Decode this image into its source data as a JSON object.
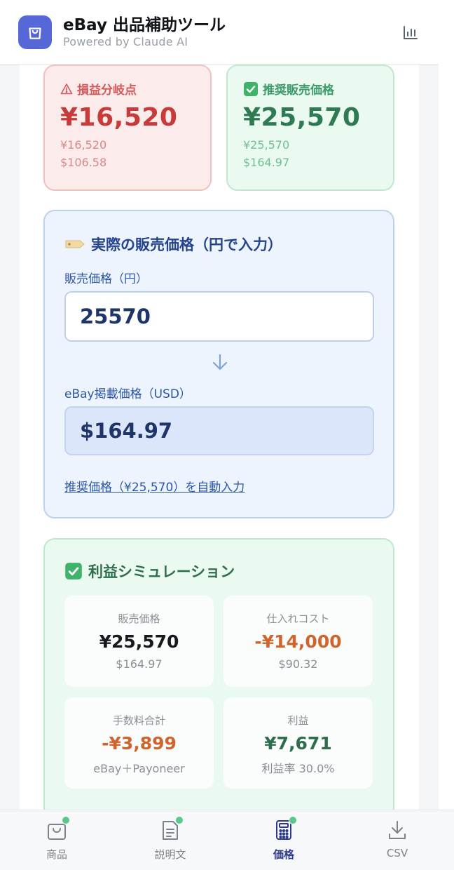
{
  "header": {
    "title": "eBay 出品補助ツール",
    "subtitle": "Powered by Claude AI"
  },
  "summary": {
    "breakeven": {
      "label": "損益分岐点",
      "value": "¥16,520",
      "sub_jpy": "¥16,520",
      "sub_usd": "$106.58"
    },
    "recommended": {
      "label": "推奨販売価格",
      "value": "¥25,570",
      "sub_jpy": "¥25,570",
      "sub_usd": "$164.97"
    }
  },
  "price_input": {
    "title": "実際の販売価格（円で入力）",
    "jpy_label": "販売価格（円）",
    "jpy_value": "25570",
    "usd_label": "eBay掲載価格（USD）",
    "usd_value": "$164.97",
    "autofill_link": "推奨価格（¥25,570）を自動入力"
  },
  "simulation": {
    "title": "利益シミュレーション",
    "tiles": [
      {
        "label": "販売価格",
        "value": "¥25,570",
        "sub": "$164.97"
      },
      {
        "label": "仕入れコスト",
        "value": "-¥14,000",
        "sub": "$90.32"
      },
      {
        "label": "手数料合計",
        "value": "-¥3,899",
        "sub": "eBay＋Payoneer"
      },
      {
        "label": "利益",
        "value": "¥7,671",
        "sub": "利益率 30.0%"
      }
    ]
  },
  "nav": {
    "items": [
      {
        "label": "商品",
        "icon": "bag-icon",
        "badge": true
      },
      {
        "label": "説明文",
        "icon": "document-icon",
        "badge": true
      },
      {
        "label": "価格",
        "icon": "calculator-icon",
        "badge": true,
        "active": true
      },
      {
        "label": "CSV",
        "icon": "download-icon",
        "badge": false
      }
    ]
  },
  "colors": {
    "accent": "#5867d8",
    "danger": "#c73b3b",
    "success": "#2f7a52",
    "cost": "#d0642d",
    "link": "#2b56a8"
  }
}
